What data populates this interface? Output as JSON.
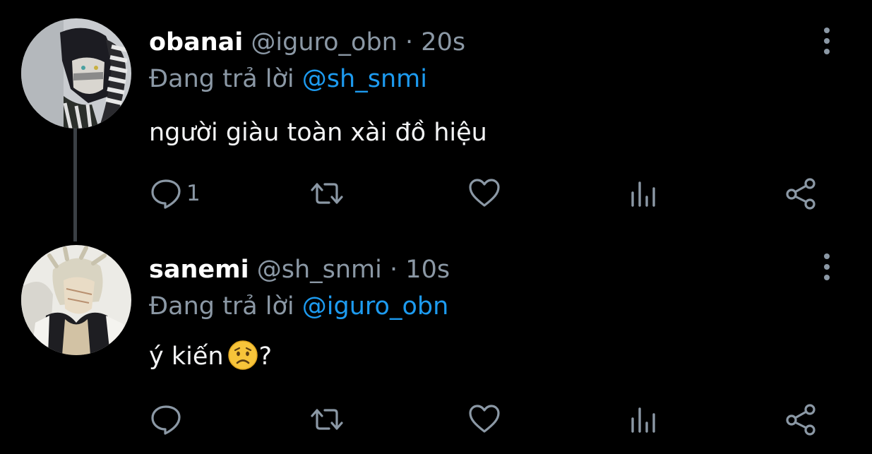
{
  "colors": {
    "background": "#000000",
    "secondary_text": "#8b98a5",
    "link": "#1d9bf0",
    "thread_line": "#3a3f44"
  },
  "tweets": [
    {
      "name": "obanai",
      "handle": "@iguro_obn",
      "separator": "·",
      "time": "20s",
      "reply_prefix": "Đang trả lời",
      "reply_to": "@sh_snmi",
      "text": "người giàu toàn xài đồ hiệu",
      "text_suffix": "",
      "reply_count": "1",
      "icons": [
        "avatar",
        "more-vertical-icon",
        "reply-icon",
        "retweet-icon",
        "like-icon",
        "stats-icon",
        "share-icon"
      ]
    },
    {
      "name": "sanemi",
      "handle": "@sh_snmi",
      "separator": "·",
      "time": "10s",
      "reply_prefix": "Đang trả lời",
      "reply_to": "@iguro_obn",
      "text": "ý kiến",
      "text_suffix": "?",
      "emoji": "worried-face",
      "reply_count": "",
      "icons": [
        "avatar",
        "more-vertical-icon",
        "reply-icon",
        "retweet-icon",
        "like-icon",
        "stats-icon",
        "share-icon"
      ]
    }
  ]
}
